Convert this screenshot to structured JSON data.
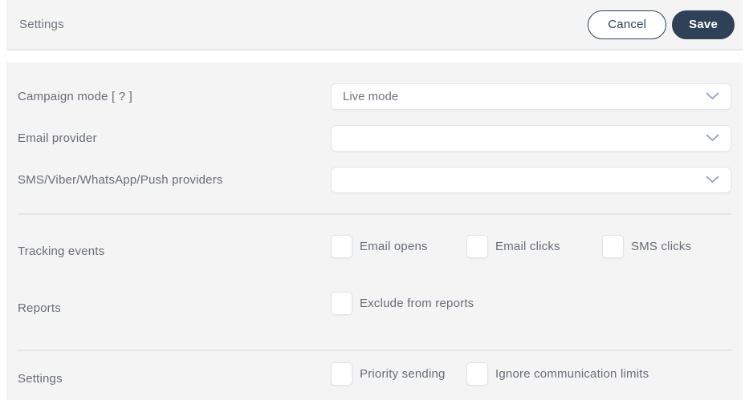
{
  "header": {
    "title": "Settings",
    "cancel_label": "Cancel",
    "save_label": "Save"
  },
  "colors": {
    "accent_navy": "#2e4156",
    "panel_background": "#f4f4f5",
    "label_text": "#676d75"
  },
  "form": {
    "selects": [
      {
        "label": "Campaign mode [ ? ]",
        "value": "Live mode"
      },
      {
        "label": "Email provider",
        "value": ""
      },
      {
        "label": "SMS/Viber/WhatsApp/Push providers",
        "value": ""
      }
    ],
    "checkbox_rows": [
      {
        "label": "Tracking events",
        "options": [
          "Email opens",
          "Email clicks",
          "SMS clicks"
        ]
      },
      {
        "label": "Reports",
        "options": [
          "Exclude from reports"
        ]
      },
      {
        "label": "Settings",
        "options": [
          "Priority sending",
          "Ignore communication limits"
        ]
      }
    ]
  }
}
